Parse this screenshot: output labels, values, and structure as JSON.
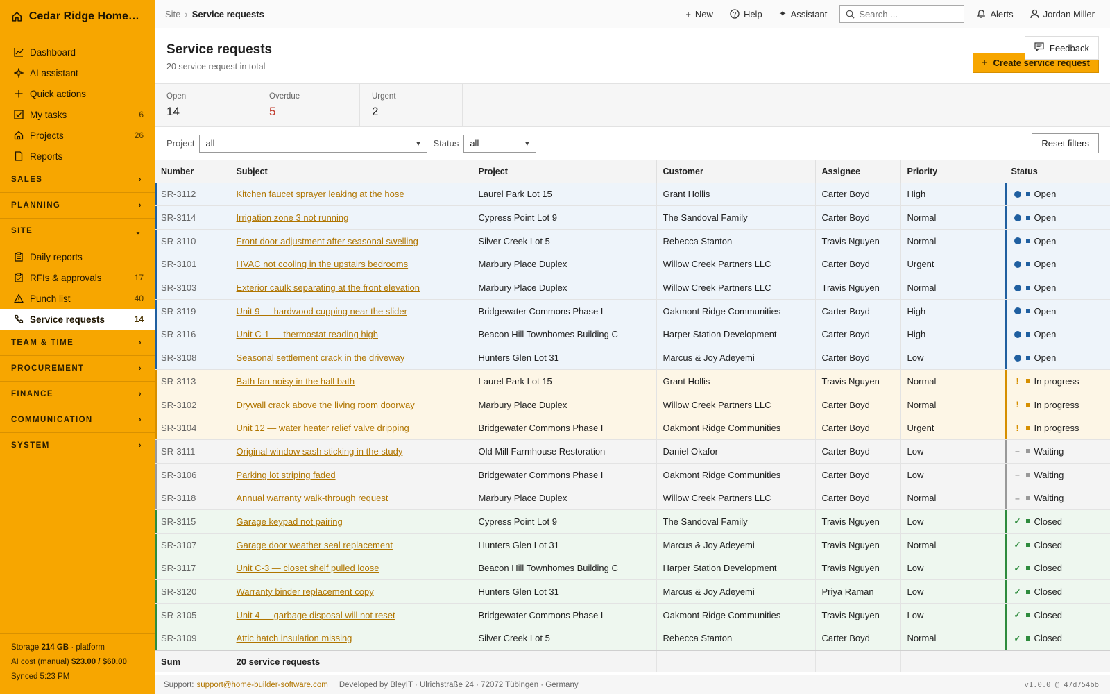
{
  "brand": {
    "name": "Cedar Ridge Homes L..."
  },
  "sidebar": {
    "top_items": [
      {
        "label": "Dashboard",
        "icon": "chart-icon",
        "count": ""
      },
      {
        "label": "AI assistant",
        "icon": "sparkle-icon",
        "count": ""
      },
      {
        "label": "Quick actions",
        "icon": "plus-icon",
        "count": ""
      },
      {
        "label": "My tasks",
        "icon": "checkbox-icon",
        "count": "6"
      },
      {
        "label": "Projects",
        "icon": "house-icon",
        "count": "26"
      },
      {
        "label": "Reports",
        "icon": "document-icon",
        "count": ""
      }
    ],
    "sections": {
      "sales": "SALES",
      "planning": "PLANNING",
      "site": "SITE",
      "team_time": "TEAM & TIME",
      "procurement": "PROCUREMENT",
      "finance": "FINANCE",
      "communication": "COMMUNICATION",
      "system": "SYSTEM"
    },
    "site_items": [
      {
        "label": "Daily reports",
        "icon": "clipboard-icon",
        "count": ""
      },
      {
        "label": "RFIs & approvals",
        "icon": "clipboard-check-icon",
        "count": "17"
      },
      {
        "label": "Punch list",
        "icon": "warning-icon",
        "count": "40"
      },
      {
        "label": "Service requests",
        "icon": "phone-icon",
        "count": "14"
      }
    ],
    "footer": {
      "storage_label": "Storage",
      "storage_value": "214 GB",
      "storage_suffix": "· platform",
      "ai_label": "AI cost (manual)",
      "ai_value": "$23.00 / $60.00",
      "synced": "Synced 5:23 PM"
    }
  },
  "topbar": {
    "crumb_root": "Site",
    "crumb_sep": "›",
    "crumb_current": "Service requests",
    "new_label": "New",
    "help_label": "Help",
    "assistant_label": "Assistant",
    "search_placeholder": "Search ...",
    "alerts_label": "Alerts",
    "user_name": "Jordan Miller"
  },
  "header": {
    "title": "Service requests",
    "subtitle": "20 service request in total",
    "feedback_label": "Feedback",
    "create_label": "Create service request"
  },
  "stats": [
    {
      "label": "Open",
      "value": "14",
      "alert": false
    },
    {
      "label": "Overdue",
      "value": "5",
      "alert": true
    },
    {
      "label": "Urgent",
      "value": "2",
      "alert": false
    }
  ],
  "filters": {
    "project_label": "Project",
    "project_value": "all",
    "status_label": "Status",
    "status_value": "all",
    "reset_label": "Reset filters"
  },
  "table": {
    "columns": [
      "Number",
      "Subject",
      "Project",
      "Customer",
      "Assignee",
      "Priority",
      "Status"
    ],
    "rows": [
      {
        "number": "SR-3112",
        "subject": "Kitchen faucet sprayer leaking at the hose",
        "project": "Laurel Park Lot 15",
        "customer": "Grant Hollis",
        "assignee": "Carter Boyd",
        "priority": "High",
        "status": "Open"
      },
      {
        "number": "SR-3114",
        "subject": "Irrigation zone 3 not running",
        "project": "Cypress Point Lot 9",
        "customer": "The Sandoval Family",
        "assignee": "Carter Boyd",
        "priority": "Normal",
        "status": "Open"
      },
      {
        "number": "SR-3110",
        "subject": "Front door adjustment after seasonal swelling",
        "project": "Silver Creek Lot 5",
        "customer": "Rebecca Stanton",
        "assignee": "Travis Nguyen",
        "priority": "Normal",
        "status": "Open"
      },
      {
        "number": "SR-3101",
        "subject": "HVAC not cooling in the upstairs bedrooms",
        "project": "Marbury Place Duplex",
        "customer": "Willow Creek Partners LLC",
        "assignee": "Carter Boyd",
        "priority": "Urgent",
        "status": "Open"
      },
      {
        "number": "SR-3103",
        "subject": "Exterior caulk separating at the front elevation",
        "project": "Marbury Place Duplex",
        "customer": "Willow Creek Partners LLC",
        "assignee": "Travis Nguyen",
        "priority": "Normal",
        "status": "Open"
      },
      {
        "number": "SR-3119",
        "subject": "Unit 9 — hardwood cupping near the slider",
        "project": "Bridgewater Commons Phase I",
        "customer": "Oakmont Ridge Communities",
        "assignee": "Carter Boyd",
        "priority": "High",
        "status": "Open"
      },
      {
        "number": "SR-3116",
        "subject": "Unit C-1 — thermostat reading high",
        "project": "Beacon Hill Townhomes Building C",
        "customer": "Harper Station Development",
        "assignee": "Carter Boyd",
        "priority": "High",
        "status": "Open"
      },
      {
        "number": "SR-3108",
        "subject": "Seasonal settlement crack in the driveway",
        "project": "Hunters Glen Lot 31",
        "customer": "Marcus & Joy Adeyemi",
        "assignee": "Carter Boyd",
        "priority": "Low",
        "status": "Open"
      },
      {
        "number": "SR-3113",
        "subject": "Bath fan noisy in the hall bath",
        "project": "Laurel Park Lot 15",
        "customer": "Grant Hollis",
        "assignee": "Travis Nguyen",
        "priority": "Normal",
        "status": "In progress"
      },
      {
        "number": "SR-3102",
        "subject": "Drywall crack above the living room doorway",
        "project": "Marbury Place Duplex",
        "customer": "Willow Creek Partners LLC",
        "assignee": "Carter Boyd",
        "priority": "Normal",
        "status": "In progress"
      },
      {
        "number": "SR-3104",
        "subject": "Unit 12 — water heater relief valve dripping",
        "project": "Bridgewater Commons Phase I",
        "customer": "Oakmont Ridge Communities",
        "assignee": "Carter Boyd",
        "priority": "Urgent",
        "status": "In progress"
      },
      {
        "number": "SR-3111",
        "subject": "Original window sash sticking in the study",
        "project": "Old Mill Farmhouse Restoration",
        "customer": "Daniel Okafor",
        "assignee": "Carter Boyd",
        "priority": "Low",
        "status": "Waiting"
      },
      {
        "number": "SR-3106",
        "subject": "Parking lot striping faded",
        "project": "Bridgewater Commons Phase I",
        "customer": "Oakmont Ridge Communities",
        "assignee": "Carter Boyd",
        "priority": "Low",
        "status": "Waiting"
      },
      {
        "number": "SR-3118",
        "subject": "Annual warranty walk-through request",
        "project": "Marbury Place Duplex",
        "customer": "Willow Creek Partners LLC",
        "assignee": "Carter Boyd",
        "priority": "Normal",
        "status": "Waiting"
      },
      {
        "number": "SR-3115",
        "subject": "Garage keypad not pairing",
        "project": "Cypress Point Lot 9",
        "customer": "The Sandoval Family",
        "assignee": "Travis Nguyen",
        "priority": "Low",
        "status": "Closed"
      },
      {
        "number": "SR-3107",
        "subject": "Garage door weather seal replacement",
        "project": "Hunters Glen Lot 31",
        "customer": "Marcus & Joy Adeyemi",
        "assignee": "Travis Nguyen",
        "priority": "Normal",
        "status": "Closed"
      },
      {
        "number": "SR-3117",
        "subject": "Unit C-3 — closet shelf pulled loose",
        "project": "Beacon Hill Townhomes Building C",
        "customer": "Harper Station Development",
        "assignee": "Travis Nguyen",
        "priority": "Low",
        "status": "Closed"
      },
      {
        "number": "SR-3120",
        "subject": "Warranty binder replacement copy",
        "project": "Hunters Glen Lot 31",
        "customer": "Marcus & Joy Adeyemi",
        "assignee": "Priya Raman",
        "priority": "Low",
        "status": "Closed"
      },
      {
        "number": "SR-3105",
        "subject": "Unit 4 — garbage disposal will not reset",
        "project": "Bridgewater Commons Phase I",
        "customer": "Oakmont Ridge Communities",
        "assignee": "Travis Nguyen",
        "priority": "Low",
        "status": "Closed"
      },
      {
        "number": "SR-3109",
        "subject": "Attic hatch insulation missing",
        "project": "Silver Creek Lot 5",
        "customer": "Rebecca Stanton",
        "assignee": "Carter Boyd",
        "priority": "Normal",
        "status": "Closed"
      }
    ],
    "sum_label": "Sum",
    "sum_value": "20 service requests"
  },
  "status_styles": {
    "Open": {
      "class": "open",
      "color": "#1f5fa0"
    },
    "In progress": {
      "class": "prog",
      "color": "#d68f00"
    },
    "Waiting": {
      "class": "wait",
      "color": "#999999"
    },
    "Closed": {
      "class": "closed",
      "color": "#2e8b3d"
    }
  },
  "footer": {
    "support_label": "Support:",
    "support_email": "support@home-builder-software.com",
    "developer": "Developed by BleyIT · Ulrichstraße 24 · 72072 Tübingen · Germany",
    "version": "v1.0.0 @ 47d754bb"
  }
}
